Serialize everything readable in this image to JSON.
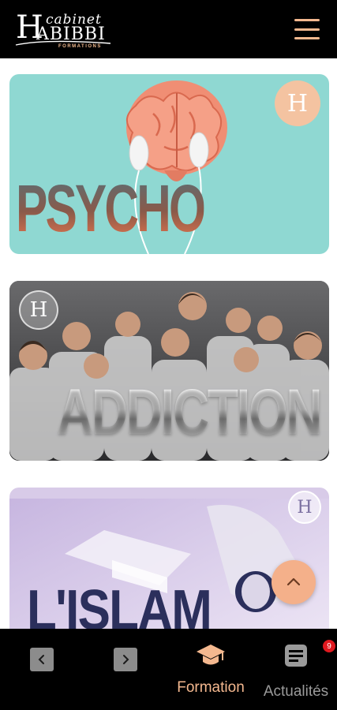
{
  "header": {
    "logo_script": "cabinet",
    "logo_letter": "H",
    "logo_word": "ABIBBI",
    "logo_sub": "FORMATIONS",
    "menu_icon": "hamburger-menu-icon"
  },
  "cards": [
    {
      "title": "PSYCHO",
      "badge": "H",
      "image": "brain-with-earbuds"
    },
    {
      "title": "ADDICTION",
      "badge": "H",
      "image": "crowd-looking-at-phones"
    },
    {
      "title": "L'ISLAM",
      "badge": "H",
      "image": "quran-and-prayer"
    }
  ],
  "fab": {
    "icon": "chevron-up-icon"
  },
  "bottom_nav": {
    "back_icon": "chevron-left-icon",
    "forward_icon": "chevron-right-icon",
    "tabs": [
      {
        "label": "Formation",
        "icon": "graduation-cap-icon",
        "active": true
      },
      {
        "label": "Actualités",
        "icon": "news-icon",
        "badge": "9",
        "active": false
      }
    ]
  },
  "colors": {
    "accent": "#f4b88f",
    "bar_background": "#000000",
    "notification": "#e0191f",
    "inactive": "#9a9a9a"
  }
}
